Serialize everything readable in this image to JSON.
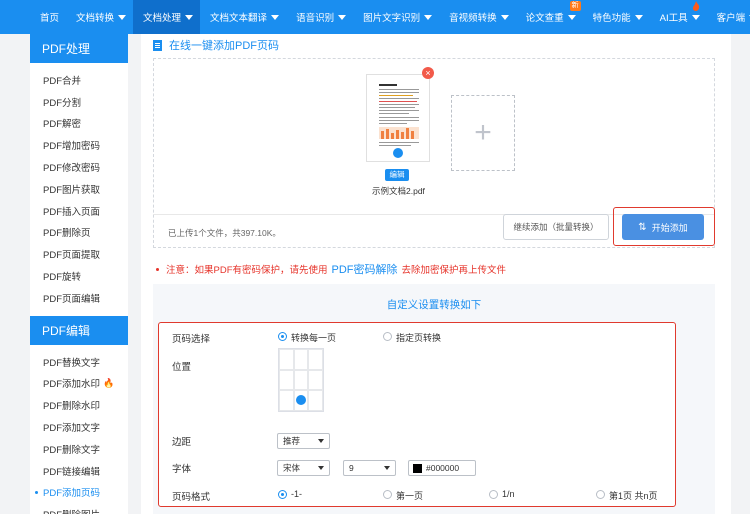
{
  "nav": {
    "items": [
      {
        "label": "首页",
        "caret": false
      },
      {
        "label": "文档转换",
        "caret": true
      },
      {
        "label": "文档处理",
        "caret": true,
        "active": true
      },
      {
        "label": "文档文本翻译",
        "caret": true
      },
      {
        "label": "语音识别",
        "caret": true
      },
      {
        "label": "图片文字识别",
        "caret": true
      },
      {
        "label": "音视频转换",
        "caret": true
      },
      {
        "label": "论文查重",
        "caret": true,
        "badge": "新"
      },
      {
        "label": "特色功能",
        "caret": true
      },
      {
        "label": "AI工具",
        "caret": true,
        "fire": true
      },
      {
        "label": "客户端",
        "caret": true
      }
    ]
  },
  "sidebar": {
    "group1_title": "PDF处理",
    "group1_items": [
      "PDF合并",
      "PDF分割",
      "PDF解密",
      "PDF增加密码",
      "PDF修改密码",
      "PDF图片获取",
      "PDF插入页面",
      "PDF删除页",
      "PDF页面提取",
      "PDF旋转",
      "PDF页面编辑"
    ],
    "group2_title": "PDF编辑",
    "group2_items": [
      "PDF替换文字",
      "PDF添加水印",
      "PDF删除水印",
      "PDF添加文字",
      "PDF删除文字",
      "PDF链接编辑",
      "PDF添加页码",
      "PDF删除图片"
    ],
    "active_item": "PDF添加页码",
    "hot_item": "PDF添加水印"
  },
  "main": {
    "section_title": "在线一键添加PDF页码",
    "file": {
      "name": "示例文档2.pdf",
      "edit_label": "编辑"
    },
    "status_text": "已上传1个文件，共397.10K。",
    "continue_button": "继续添加（批量转换）",
    "start_button": "开始添加",
    "notice_prefix": "注意：如果PDF有密码保护，请先使用",
    "notice_link": "PDF密码解除",
    "notice_suffix": "去除加密保护再上传文件"
  },
  "settings": {
    "title": "自定义设置转换如下",
    "page_select": {
      "label": "页码选择",
      "options": [
        "转换每一页",
        "指定页转换"
      ],
      "selected": 0
    },
    "position": {
      "label": "位置",
      "selected_cell": "bottom-center"
    },
    "margin": {
      "label": "边距",
      "value": "推荐"
    },
    "font": {
      "label": "字体",
      "family": "宋体",
      "size": "9",
      "color_value": "#000000",
      "color_hex": "#000000"
    },
    "format": {
      "label": "页码格式",
      "options": [
        "-1-",
        "第一页",
        "1/n",
        "第1页 共n页"
      ],
      "selected": 0
    }
  },
  "colors": {
    "primary": "#1a8ef0",
    "highlight_border": "#e03a2e",
    "warning": "#e6332a"
  }
}
